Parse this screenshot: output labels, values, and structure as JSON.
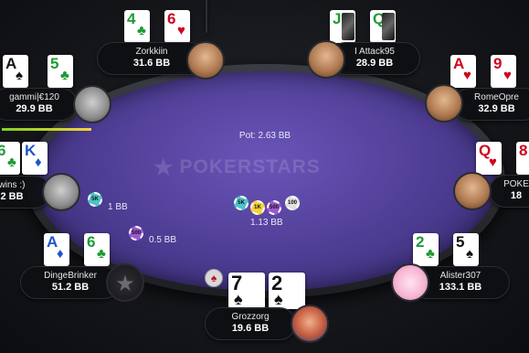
{
  "table": {
    "brand": "POKERSTARS",
    "pot_label": "Pot: 2.63 BB",
    "center_bet": "1.13 BB"
  },
  "players": {
    "zorkkiin": {
      "name": "Zorkkiin",
      "stack": "31.6 BB",
      "cards": [
        {
          "rank": "4",
          "suit": "♣",
          "color": "green"
        },
        {
          "rank": "6",
          "suit": "♥",
          "color": "red"
        }
      ]
    },
    "attack95": {
      "name": "I Attack95",
      "stack": "28.9 BB",
      "cards": [
        {
          "rank": "J",
          "suit": "♣",
          "color": "green"
        },
        {
          "rank": "Q",
          "suit": "♠",
          "color": "black"
        }
      ]
    },
    "gammi": {
      "name": "gammi|€120",
      "stack": "29.9 BB",
      "cards": [
        {
          "rank": "A",
          "suit": "♠",
          "color": "black"
        },
        {
          "rank": "5",
          "suit": "♣",
          "color": "green"
        }
      ]
    },
    "romeo": {
      "name": "RomeOpre",
      "stack": "32.9 BB",
      "cards": [
        {
          "rank": "A",
          "suit": "♥",
          "color": "red"
        },
        {
          "rank": "9",
          "suit": "♥",
          "color": "red"
        }
      ]
    },
    "wins": {
      "name": "wins :)",
      "stack": "2 BB",
      "bet": "1 BB",
      "cards": [
        {
          "rank": "6",
          "suit": "♣",
          "color": "green"
        },
        {
          "rank": "K",
          "suit": "♦",
          "color": "blue"
        }
      ]
    },
    "poke": {
      "name": "POKE",
      "stack": "18",
      "cards": [
        {
          "rank": "Q",
          "suit": "♥",
          "color": "red"
        },
        {
          "rank": "8",
          "suit": "♥",
          "color": "red"
        }
      ]
    },
    "dinge": {
      "name": "DingeBrinker",
      "stack": "51.2 BB",
      "bet": "0.5 BB",
      "cards": [
        {
          "rank": "A",
          "suit": "♦",
          "color": "blue"
        },
        {
          "rank": "6",
          "suit": "♣",
          "color": "green"
        }
      ]
    },
    "alister": {
      "name": "Alister307",
      "stack": "133.1 BB",
      "cards": [
        {
          "rank": "2",
          "suit": "♣",
          "color": "green"
        },
        {
          "rank": "5",
          "suit": "♠",
          "color": "black"
        }
      ]
    },
    "grozzorg": {
      "name": "Grozzorg",
      "stack": "19.6 BB",
      "cards": [
        {
          "rank": "7",
          "suit": "♠",
          "color": "black"
        },
        {
          "rank": "2",
          "suit": "♠",
          "color": "black"
        }
      ]
    }
  },
  "chips": {
    "c5k": "5K",
    "c1k": "1K",
    "c500": "500",
    "c100": "100"
  },
  "gammi_timer_fraction": 1.0,
  "colors": {
    "felt": "#4d3c92",
    "red_suit": "#d0021b",
    "green_suit": "#1f9a35",
    "blue_suit": "#1e55c8"
  }
}
